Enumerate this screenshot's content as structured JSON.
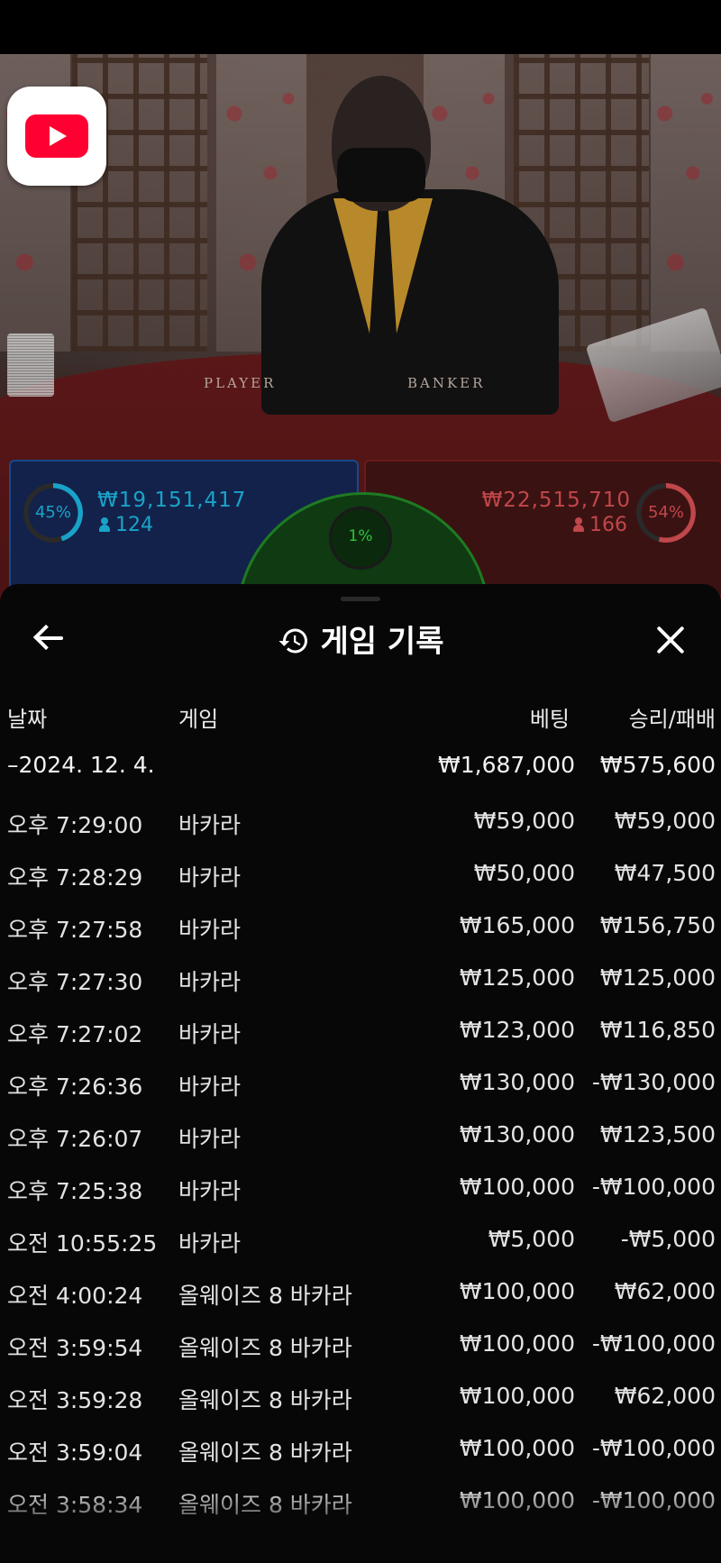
{
  "video": {
    "table_labels": [
      "PLAYER",
      "BANKER"
    ]
  },
  "bets": {
    "player": {
      "percent": "45%",
      "percent_value": 45,
      "amount": "₩19,151,417",
      "players": "124",
      "color": "#1aa3c9"
    },
    "tie": {
      "percent": "1%",
      "percent_value": 1,
      "color": "#2fc23a"
    },
    "banker": {
      "percent": "54%",
      "percent_value": 54,
      "amount": "₩22,515,710",
      "players": "166",
      "color": "#c0474a"
    }
  },
  "history": {
    "title": "게임 기록",
    "columns": {
      "date": "날짜",
      "game": "게임",
      "bet": "베팅",
      "winloss": "승리/패배"
    },
    "date_group": {
      "date": "–2024. 12. 4.",
      "bet": "₩1,687,000",
      "winloss": "₩575,600"
    },
    "rows": [
      {
        "time": "오후 7:29:00",
        "game": "바카라",
        "bet": "₩59,000",
        "winloss": "₩59,000"
      },
      {
        "time": "오후 7:28:29",
        "game": "바카라",
        "bet": "₩50,000",
        "winloss": "₩47,500"
      },
      {
        "time": "오후 7:27:58",
        "game": "바카라",
        "bet": "₩165,000",
        "winloss": "₩156,750"
      },
      {
        "time": "오후 7:27:30",
        "game": "바카라",
        "bet": "₩125,000",
        "winloss": "₩125,000"
      },
      {
        "time": "오후 7:27:02",
        "game": "바카라",
        "bet": "₩123,000",
        "winloss": "₩116,850"
      },
      {
        "time": "오후 7:26:36",
        "game": "바카라",
        "bet": "₩130,000",
        "winloss": "-₩130,000"
      },
      {
        "time": "오후 7:26:07",
        "game": "바카라",
        "bet": "₩130,000",
        "winloss": "₩123,500"
      },
      {
        "time": "오후 7:25:38",
        "game": "바카라",
        "bet": "₩100,000",
        "winloss": "-₩100,000"
      },
      {
        "time": "오전 10:55:25",
        "game": "바카라",
        "bet": "₩5,000",
        "winloss": "-₩5,000"
      },
      {
        "time": "오전 4:00:24",
        "game": "올웨이즈 8 바카라",
        "bet": "₩100,000",
        "winloss": "₩62,000"
      },
      {
        "time": "오전 3:59:54",
        "game": "올웨이즈 8 바카라",
        "bet": "₩100,000",
        "winloss": "-₩100,000"
      },
      {
        "time": "오전 3:59:28",
        "game": "올웨이즈 8 바카라",
        "bet": "₩100,000",
        "winloss": "₩62,000"
      },
      {
        "time": "오전 3:59:04",
        "game": "올웨이즈 8 바카라",
        "bet": "₩100,000",
        "winloss": "-₩100,000"
      },
      {
        "time": "오전 3:58:34",
        "game": "올웨이즈 8 바카라",
        "bet": "₩100,000",
        "winloss": "-₩100,000"
      }
    ]
  }
}
